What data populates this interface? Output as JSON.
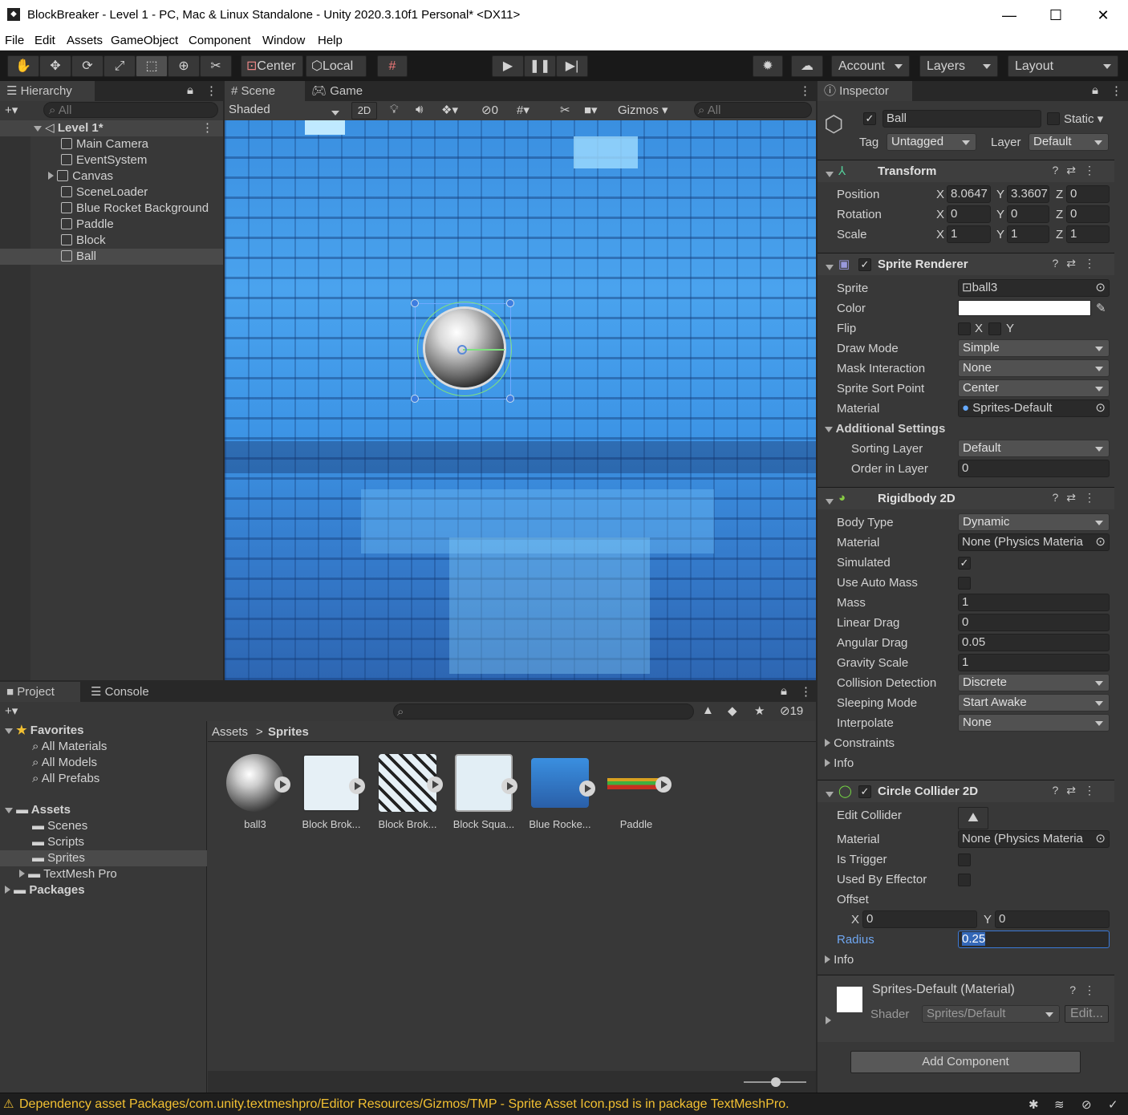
{
  "window": {
    "title": "BlockBreaker - Level 1 - PC, Mac & Linux Standalone - Unity 2020.3.10f1 Personal* <DX11>"
  },
  "menu": [
    "File",
    "Edit",
    "Assets",
    "GameObject",
    "Component",
    "Window",
    "Help"
  ],
  "toolbar": {
    "center": "Center",
    "local": "Local",
    "account": "Account",
    "layers": "Layers",
    "layout": "Layout"
  },
  "hierarchy": {
    "tab": "Hierarchy",
    "search": "All",
    "scene": "Level 1*",
    "items": [
      "Main Camera",
      "EventSystem",
      "Canvas",
      "SceneLoader",
      "Blue Rocket Background",
      "Paddle",
      "Block",
      "Ball"
    ]
  },
  "scene_view": {
    "tab_scene": "Scene",
    "tab_game": "Game",
    "shading": "Shaded",
    "mode2d": "2D",
    "hidden_count": "0",
    "gizmos": "Gizmos",
    "search": "All"
  },
  "project": {
    "tab_project": "Project",
    "tab_console": "Console",
    "hidden_count": "19",
    "favorites": "Favorites",
    "fav_items": [
      "All Materials",
      "All Models",
      "All Prefabs"
    ],
    "assets": "Assets",
    "asset_folders": [
      "Scenes",
      "Scripts",
      "Sprites",
      "TextMesh Pro"
    ],
    "packages": "Packages",
    "breadcrumb_root": "Assets",
    "breadcrumb_current": "Sprites",
    "files": [
      "ball3",
      "Block Brok...",
      "Block Brok...",
      "Block Squa...",
      "Blue Rocke...",
      "Paddle"
    ]
  },
  "inspector": {
    "tab": "Inspector",
    "object_name": "Ball",
    "static_label": "Static",
    "tag_label": "Tag",
    "tag": "Untagged",
    "layer_label": "Layer",
    "layer": "Default",
    "transform": {
      "title": "Transform",
      "position_label": "Position",
      "rotation_label": "Rotation",
      "scale_label": "Scale",
      "pos": [
        "8.0647",
        "3.3607",
        "0"
      ],
      "rot": [
        "0",
        "0",
        "0"
      ],
      "scale": [
        "1",
        "1",
        "1"
      ]
    },
    "sprite_renderer": {
      "title": "Sprite Renderer",
      "sprite_label": "Sprite",
      "sprite": "ball3",
      "color_label": "Color",
      "color": "#ffffff",
      "flip_label": "Flip",
      "draw_mode_label": "Draw Mode",
      "draw_mode": "Simple",
      "mask_label": "Mask Interaction",
      "mask": "None",
      "sort_point_label": "Sprite Sort Point",
      "sort_point": "Center",
      "material_label": "Material",
      "material": "Sprites-Default",
      "additional": "Additional Settings",
      "sorting_layer_label": "Sorting Layer",
      "sorting_layer": "Default",
      "order_label": "Order in Layer",
      "order": "0"
    },
    "rigidbody": {
      "title": "Rigidbody 2D",
      "body_type_label": "Body Type",
      "body_type": "Dynamic",
      "material_label": "Material",
      "material": "None (Physics Materia",
      "simulated_label": "Simulated",
      "auto_mass_label": "Use Auto Mass",
      "mass_label": "Mass",
      "mass": "1",
      "linear_drag_label": "Linear Drag",
      "linear_drag": "0",
      "angular_drag_label": "Angular Drag",
      "angular_drag": "0.05",
      "gravity_label": "Gravity Scale",
      "gravity": "1",
      "collision_label": "Collision Detection",
      "collision": "Discrete",
      "sleeping_label": "Sleeping Mode",
      "sleeping": "Start Awake",
      "interpolate_label": "Interpolate",
      "interpolate": "None",
      "constraints": "Constraints",
      "info": "Info"
    },
    "circle_collider": {
      "title": "Circle Collider 2D",
      "edit_label": "Edit Collider",
      "material_label": "Material",
      "material": "None (Physics Materia",
      "trigger_label": "Is Trigger",
      "effector_label": "Used By Effector",
      "offset_label": "Offset",
      "offset_x": "0",
      "offset_y": "0",
      "radius_label": "Radius",
      "radius": "0.25",
      "info": "Info"
    },
    "material_preview": {
      "name": "Sprites-Default (Material)",
      "shader_label": "Shader",
      "shader": "Sprites/Default",
      "edit": "Edit..."
    },
    "add_component": "Add Component"
  },
  "status": {
    "message": "Dependency asset Packages/com.unity.textmeshpro/Editor Resources/Gizmos/TMP - Sprite Asset Icon.psd is in package TextMeshPro."
  }
}
